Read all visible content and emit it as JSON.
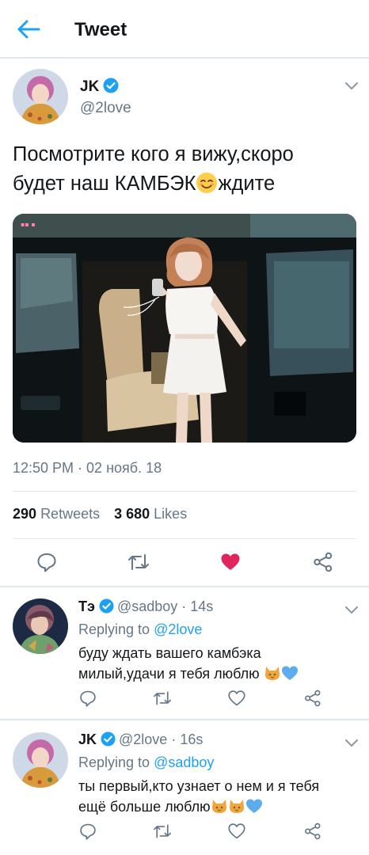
{
  "header": {
    "title": "Tweet",
    "back_icon": "arrow-left-icon"
  },
  "colors": {
    "accent": "#1da1f2",
    "muted": "#657786",
    "like": "#e0245e",
    "divider": "#e1e8ed"
  },
  "tweet": {
    "name": "JK",
    "handle": "@2love",
    "text_line1": "Посмотрите кого я вижу,скоро",
    "text_line2_a": "будет наш КАМБЭК",
    "text_line2_b": "ждите",
    "timestamp": "12:50 PM · 02 нояб. 18",
    "retweets_count": "290",
    "retweets_label": "Retweets",
    "likes_count": "3 680",
    "likes_label": "Likes",
    "liked": true
  },
  "replies": [
    {
      "name": "Тэ",
      "handle": "@sadboy · 14s",
      "replying_prefix": "Replying to",
      "replying_to": "@2love",
      "text_line1": "буду ждать вашего камбэка",
      "text_line2": "милый,удачи я тебя люблю"
    },
    {
      "name": "JK",
      "handle": "@2love · 16s",
      "replying_prefix": "Replying to",
      "replying_to": "@sadboy",
      "text_line1": "ты первый,кто узнает о нем и я тебя",
      "text_line2": "ещё больше люблю"
    }
  ]
}
